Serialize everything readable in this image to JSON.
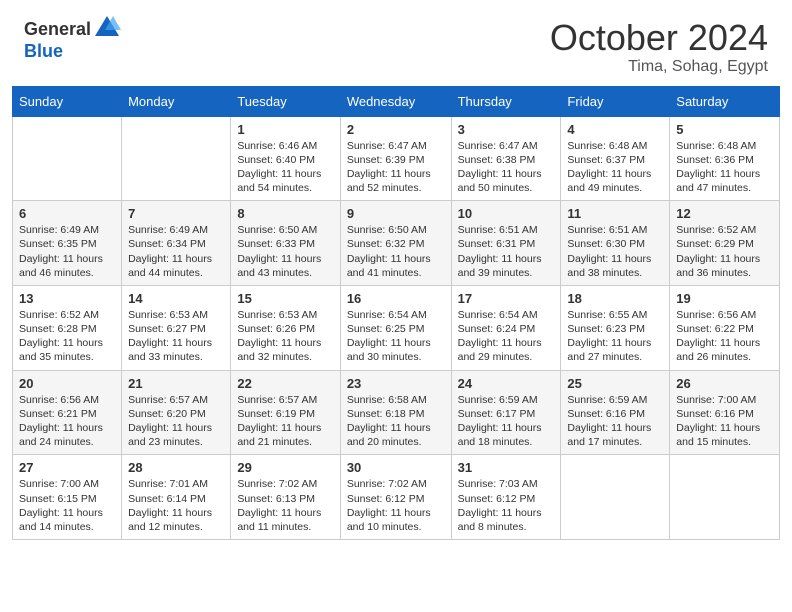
{
  "header": {
    "logo_general": "General",
    "logo_blue": "Blue",
    "month_title": "October 2024",
    "location": "Tima, Sohag, Egypt"
  },
  "weekdays": [
    "Sunday",
    "Monday",
    "Tuesday",
    "Wednesday",
    "Thursday",
    "Friday",
    "Saturday"
  ],
  "weeks": [
    [
      {
        "day": null
      },
      {
        "day": null
      },
      {
        "day": "1",
        "sunrise": "Sunrise: 6:46 AM",
        "sunset": "Sunset: 6:40 PM",
        "daylight": "Daylight: 11 hours and 54 minutes."
      },
      {
        "day": "2",
        "sunrise": "Sunrise: 6:47 AM",
        "sunset": "Sunset: 6:39 PM",
        "daylight": "Daylight: 11 hours and 52 minutes."
      },
      {
        "day": "3",
        "sunrise": "Sunrise: 6:47 AM",
        "sunset": "Sunset: 6:38 PM",
        "daylight": "Daylight: 11 hours and 50 minutes."
      },
      {
        "day": "4",
        "sunrise": "Sunrise: 6:48 AM",
        "sunset": "Sunset: 6:37 PM",
        "daylight": "Daylight: 11 hours and 49 minutes."
      },
      {
        "day": "5",
        "sunrise": "Sunrise: 6:48 AM",
        "sunset": "Sunset: 6:36 PM",
        "daylight": "Daylight: 11 hours and 47 minutes."
      }
    ],
    [
      {
        "day": "6",
        "sunrise": "Sunrise: 6:49 AM",
        "sunset": "Sunset: 6:35 PM",
        "daylight": "Daylight: 11 hours and 46 minutes."
      },
      {
        "day": "7",
        "sunrise": "Sunrise: 6:49 AM",
        "sunset": "Sunset: 6:34 PM",
        "daylight": "Daylight: 11 hours and 44 minutes."
      },
      {
        "day": "8",
        "sunrise": "Sunrise: 6:50 AM",
        "sunset": "Sunset: 6:33 PM",
        "daylight": "Daylight: 11 hours and 43 minutes."
      },
      {
        "day": "9",
        "sunrise": "Sunrise: 6:50 AM",
        "sunset": "Sunset: 6:32 PM",
        "daylight": "Daylight: 11 hours and 41 minutes."
      },
      {
        "day": "10",
        "sunrise": "Sunrise: 6:51 AM",
        "sunset": "Sunset: 6:31 PM",
        "daylight": "Daylight: 11 hours and 39 minutes."
      },
      {
        "day": "11",
        "sunrise": "Sunrise: 6:51 AM",
        "sunset": "Sunset: 6:30 PM",
        "daylight": "Daylight: 11 hours and 38 minutes."
      },
      {
        "day": "12",
        "sunrise": "Sunrise: 6:52 AM",
        "sunset": "Sunset: 6:29 PM",
        "daylight": "Daylight: 11 hours and 36 minutes."
      }
    ],
    [
      {
        "day": "13",
        "sunrise": "Sunrise: 6:52 AM",
        "sunset": "Sunset: 6:28 PM",
        "daylight": "Daylight: 11 hours and 35 minutes."
      },
      {
        "day": "14",
        "sunrise": "Sunrise: 6:53 AM",
        "sunset": "Sunset: 6:27 PM",
        "daylight": "Daylight: 11 hours and 33 minutes."
      },
      {
        "day": "15",
        "sunrise": "Sunrise: 6:53 AM",
        "sunset": "Sunset: 6:26 PM",
        "daylight": "Daylight: 11 hours and 32 minutes."
      },
      {
        "day": "16",
        "sunrise": "Sunrise: 6:54 AM",
        "sunset": "Sunset: 6:25 PM",
        "daylight": "Daylight: 11 hours and 30 minutes."
      },
      {
        "day": "17",
        "sunrise": "Sunrise: 6:54 AM",
        "sunset": "Sunset: 6:24 PM",
        "daylight": "Daylight: 11 hours and 29 minutes."
      },
      {
        "day": "18",
        "sunrise": "Sunrise: 6:55 AM",
        "sunset": "Sunset: 6:23 PM",
        "daylight": "Daylight: 11 hours and 27 minutes."
      },
      {
        "day": "19",
        "sunrise": "Sunrise: 6:56 AM",
        "sunset": "Sunset: 6:22 PM",
        "daylight": "Daylight: 11 hours and 26 minutes."
      }
    ],
    [
      {
        "day": "20",
        "sunrise": "Sunrise: 6:56 AM",
        "sunset": "Sunset: 6:21 PM",
        "daylight": "Daylight: 11 hours and 24 minutes."
      },
      {
        "day": "21",
        "sunrise": "Sunrise: 6:57 AM",
        "sunset": "Sunset: 6:20 PM",
        "daylight": "Daylight: 11 hours and 23 minutes."
      },
      {
        "day": "22",
        "sunrise": "Sunrise: 6:57 AM",
        "sunset": "Sunset: 6:19 PM",
        "daylight": "Daylight: 11 hours and 21 minutes."
      },
      {
        "day": "23",
        "sunrise": "Sunrise: 6:58 AM",
        "sunset": "Sunset: 6:18 PM",
        "daylight": "Daylight: 11 hours and 20 minutes."
      },
      {
        "day": "24",
        "sunrise": "Sunrise: 6:59 AM",
        "sunset": "Sunset: 6:17 PM",
        "daylight": "Daylight: 11 hours and 18 minutes."
      },
      {
        "day": "25",
        "sunrise": "Sunrise: 6:59 AM",
        "sunset": "Sunset: 6:16 PM",
        "daylight": "Daylight: 11 hours and 17 minutes."
      },
      {
        "day": "26",
        "sunrise": "Sunrise: 7:00 AM",
        "sunset": "Sunset: 6:16 PM",
        "daylight": "Daylight: 11 hours and 15 minutes."
      }
    ],
    [
      {
        "day": "27",
        "sunrise": "Sunrise: 7:00 AM",
        "sunset": "Sunset: 6:15 PM",
        "daylight": "Daylight: 11 hours and 14 minutes."
      },
      {
        "day": "28",
        "sunrise": "Sunrise: 7:01 AM",
        "sunset": "Sunset: 6:14 PM",
        "daylight": "Daylight: 11 hours and 12 minutes."
      },
      {
        "day": "29",
        "sunrise": "Sunrise: 7:02 AM",
        "sunset": "Sunset: 6:13 PM",
        "daylight": "Daylight: 11 hours and 11 minutes."
      },
      {
        "day": "30",
        "sunrise": "Sunrise: 7:02 AM",
        "sunset": "Sunset: 6:12 PM",
        "daylight": "Daylight: 11 hours and 10 minutes."
      },
      {
        "day": "31",
        "sunrise": "Sunrise: 7:03 AM",
        "sunset": "Sunset: 6:12 PM",
        "daylight": "Daylight: 11 hours and 8 minutes."
      },
      {
        "day": null
      },
      {
        "day": null
      }
    ]
  ]
}
